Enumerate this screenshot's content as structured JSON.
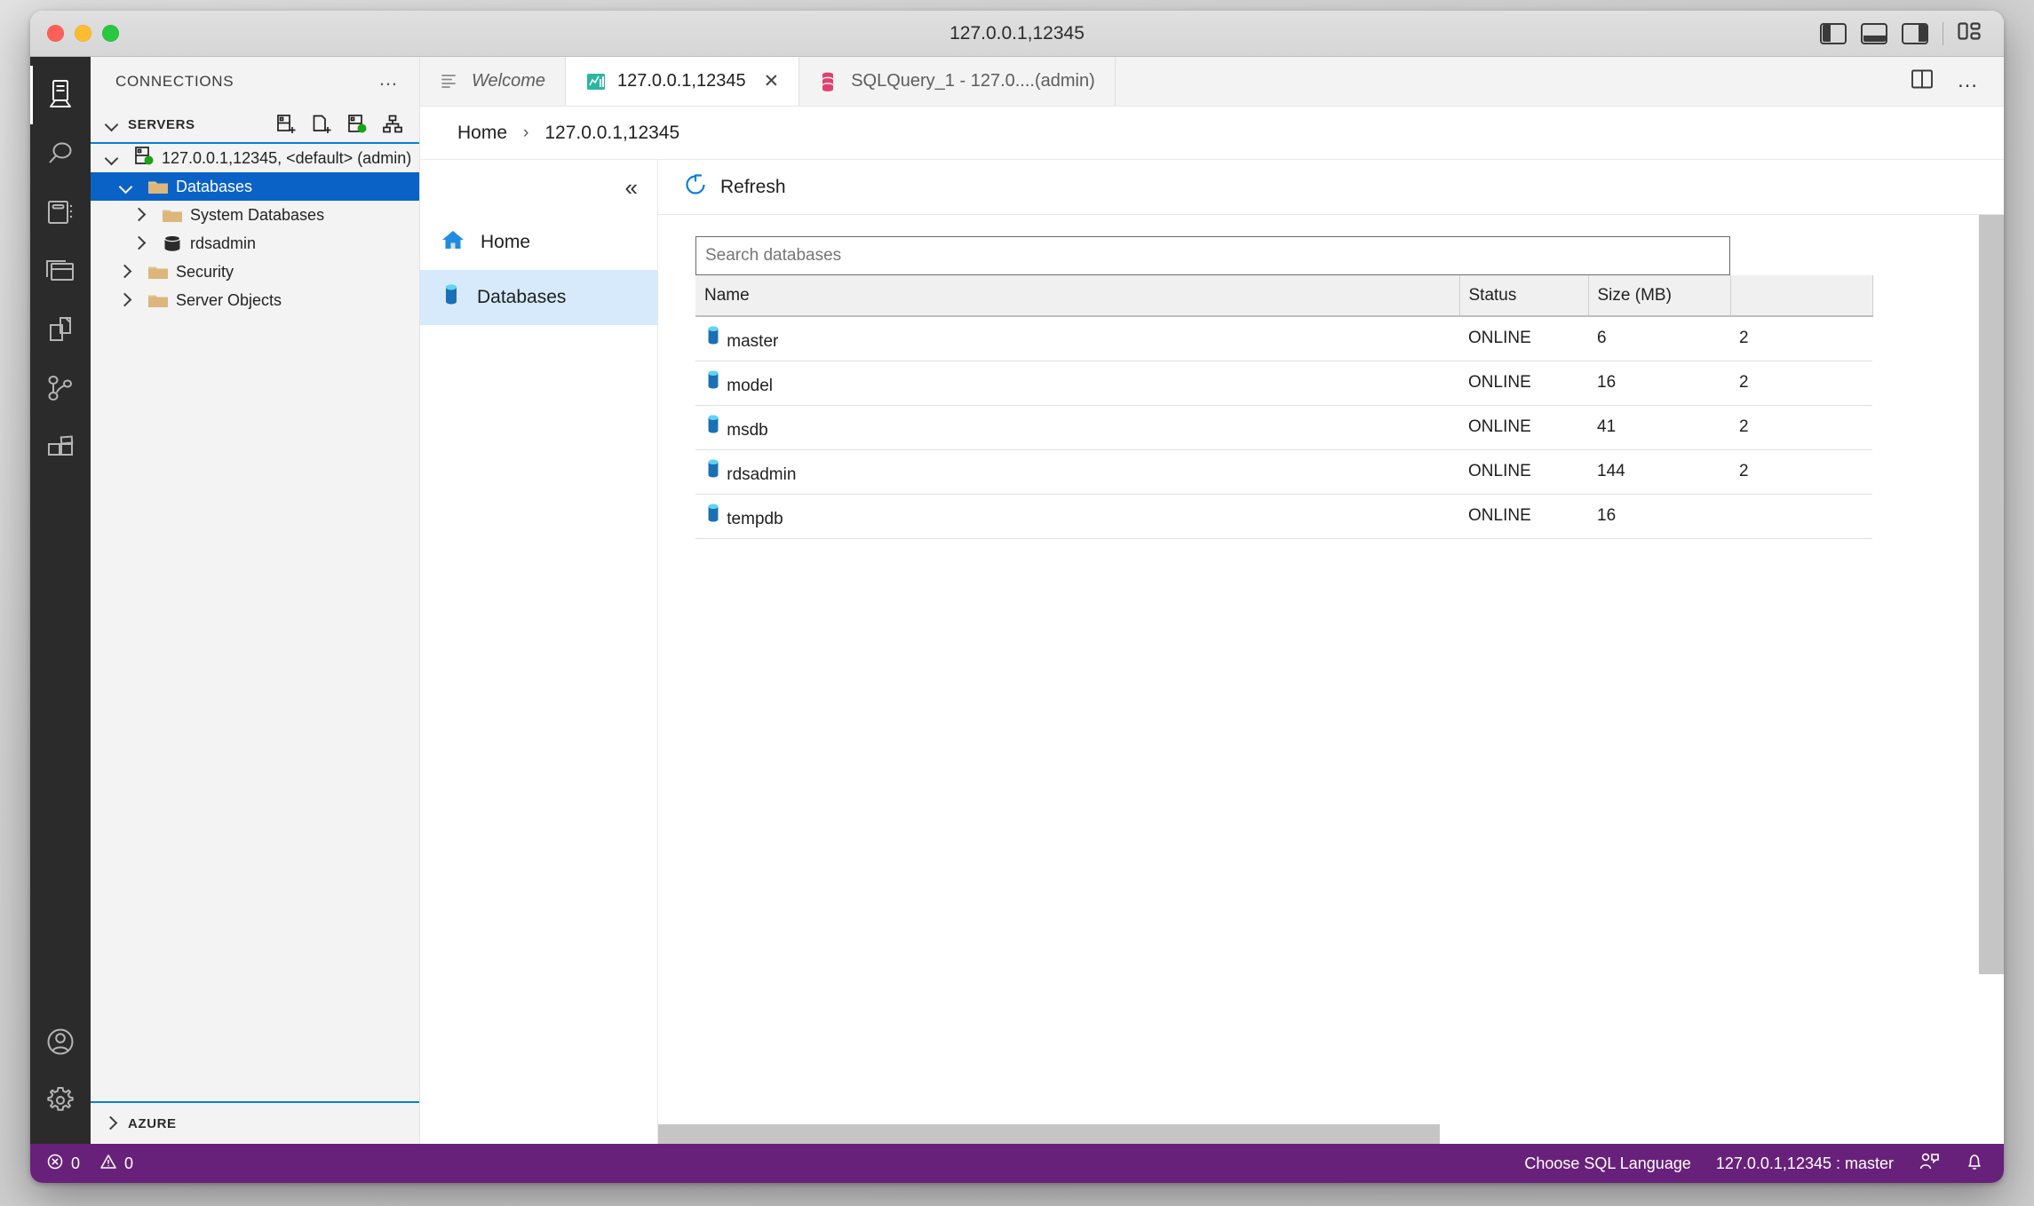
{
  "window": {
    "title": "127.0.0.1,12345",
    "traffic_lights": [
      "close",
      "minimize",
      "zoom"
    ],
    "layout_toggles": [
      "toggle-primary-sidebar",
      "toggle-panel",
      "toggle-secondary-sidebar",
      "customize-layout"
    ]
  },
  "activitybar": {
    "items": [
      {
        "name": "servers",
        "icon": "server-icon",
        "active": true
      },
      {
        "name": "search",
        "icon": "search-icon",
        "active": false
      },
      {
        "name": "notebooks",
        "icon": "notebook-icon",
        "active": false
      },
      {
        "name": "query-history",
        "icon": "window-stack-icon",
        "active": false
      },
      {
        "name": "explorer",
        "icon": "files-icon",
        "active": false
      },
      {
        "name": "source-control",
        "icon": "source-control-icon",
        "active": false
      },
      {
        "name": "extensions",
        "icon": "extensions-icon",
        "active": false
      }
    ],
    "bottom_items": [
      {
        "name": "accounts",
        "icon": "account-icon"
      },
      {
        "name": "settings",
        "icon": "gear-icon"
      }
    ]
  },
  "sidebar": {
    "title": "CONNECTIONS",
    "more_label": "…",
    "sections": [
      {
        "id": "servers",
        "label": "SERVERS",
        "expanded": true
      },
      {
        "id": "azure",
        "label": "AZURE",
        "expanded": false
      }
    ],
    "server_actions": [
      {
        "name": "new-connection",
        "icon": "new-connection-icon"
      },
      {
        "name": "new-server-group",
        "icon": "new-server-group-icon"
      },
      {
        "name": "connect-server",
        "icon": "connected-server-icon"
      },
      {
        "name": "server-groups-view",
        "icon": "server-hierarchy-icon"
      }
    ],
    "tree": [
      {
        "label": "127.0.0.1,12345, <default> (admin)",
        "icon": "connected-server-icon",
        "depth": 0,
        "expanded": true,
        "selected": false,
        "focused": true
      },
      {
        "label": "Databases",
        "icon": "folder-icon",
        "depth": 1,
        "expanded": true,
        "selected": true
      },
      {
        "label": "System Databases",
        "icon": "folder-icon",
        "depth": 2,
        "expanded": false,
        "selected": false
      },
      {
        "label": "rdsadmin",
        "icon": "database-dark-icon",
        "depth": 2,
        "expanded": false,
        "selected": false
      },
      {
        "label": "Security",
        "icon": "folder-icon",
        "depth": 1,
        "expanded": false,
        "selected": false
      },
      {
        "label": "Server Objects",
        "icon": "folder-icon",
        "depth": 1,
        "expanded": false,
        "selected": false
      }
    ]
  },
  "tabs": {
    "items": [
      {
        "label": "Welcome",
        "icon": "welcome-icon",
        "active": false,
        "italic": true,
        "closable": false
      },
      {
        "label": "127.0.0.1,12345",
        "icon": "dashboard-icon",
        "active": true,
        "italic": false,
        "closable": true,
        "close_label": "✕"
      },
      {
        "label": "SQLQuery_1 - 127.0....(admin)",
        "icon": "query-icon",
        "active": false,
        "italic": false,
        "closable": false
      }
    ],
    "actions": [
      {
        "name": "split-editor",
        "icon": "split-editor-icon"
      },
      {
        "name": "more-actions",
        "icon": "ellipsis-icon",
        "label": "…"
      }
    ]
  },
  "breadcrumb": {
    "items": [
      "Home",
      "127.0.0.1,12345"
    ],
    "separator": "›"
  },
  "dashboard_nav": {
    "collapse_label": "«",
    "items": [
      {
        "label": "Home",
        "icon": "home-icon",
        "active": false
      },
      {
        "label": "Databases",
        "icon": "database-icon",
        "active": true
      }
    ]
  },
  "toolbar": {
    "refresh_label": "Refresh",
    "refresh_icon": "refresh-icon"
  },
  "databases_grid": {
    "search_placeholder": "Search databases",
    "search_value": "",
    "columns": [
      "Name",
      "Status",
      "Size (MB)",
      ""
    ],
    "rows": [
      {
        "name": "master",
        "icon": "database-icon",
        "status": "ONLINE",
        "size": "6",
        "extra": "2"
      },
      {
        "name": "model",
        "icon": "database-icon",
        "status": "ONLINE",
        "size": "16",
        "extra": "2"
      },
      {
        "name": "msdb",
        "icon": "database-icon",
        "status": "ONLINE",
        "size": "41",
        "extra": "2"
      },
      {
        "name": "rdsadmin",
        "icon": "database-icon",
        "status": "ONLINE",
        "size": "144",
        "extra": "2"
      },
      {
        "name": "tempdb",
        "icon": "database-icon",
        "status": "ONLINE",
        "size": "16",
        "extra": ""
      }
    ]
  },
  "statusbar": {
    "error_icon": "error-circle-icon",
    "error_count": "0",
    "warning_icon": "warning-triangle-icon",
    "warning_count": "0",
    "language_label": "Choose SQL Language",
    "connection_label": "127.0.0.1,12345 : master",
    "feedback_icon": "feedback-icon",
    "bell_icon": "bell-icon",
    "background": "#68217a"
  },
  "colors": {
    "accent_blue": "#0a62c7",
    "focus_blue": "#0a7fd6",
    "nav_active": "#d6eafb",
    "status_purple": "#68217a",
    "folder_tan": "#dcb67a",
    "db_blue": "#1b75bb"
  }
}
